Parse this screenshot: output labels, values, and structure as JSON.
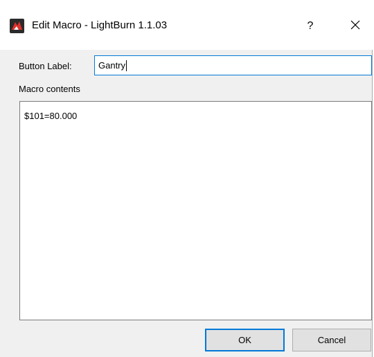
{
  "window": {
    "title": "Edit Macro - LightBurn 1.1.03",
    "help_label": "?",
    "icons": {
      "app": "lightburn-logo-icon",
      "close": "close-icon"
    },
    "accent_color": "#0078d7"
  },
  "form": {
    "button_label_caption": "Button Label:",
    "button_label_value": "Gantry",
    "macro_contents_caption": "Macro contents",
    "macro_contents_value": "$101=80.000"
  },
  "buttons": {
    "ok_label": "OK",
    "cancel_label": "Cancel"
  }
}
